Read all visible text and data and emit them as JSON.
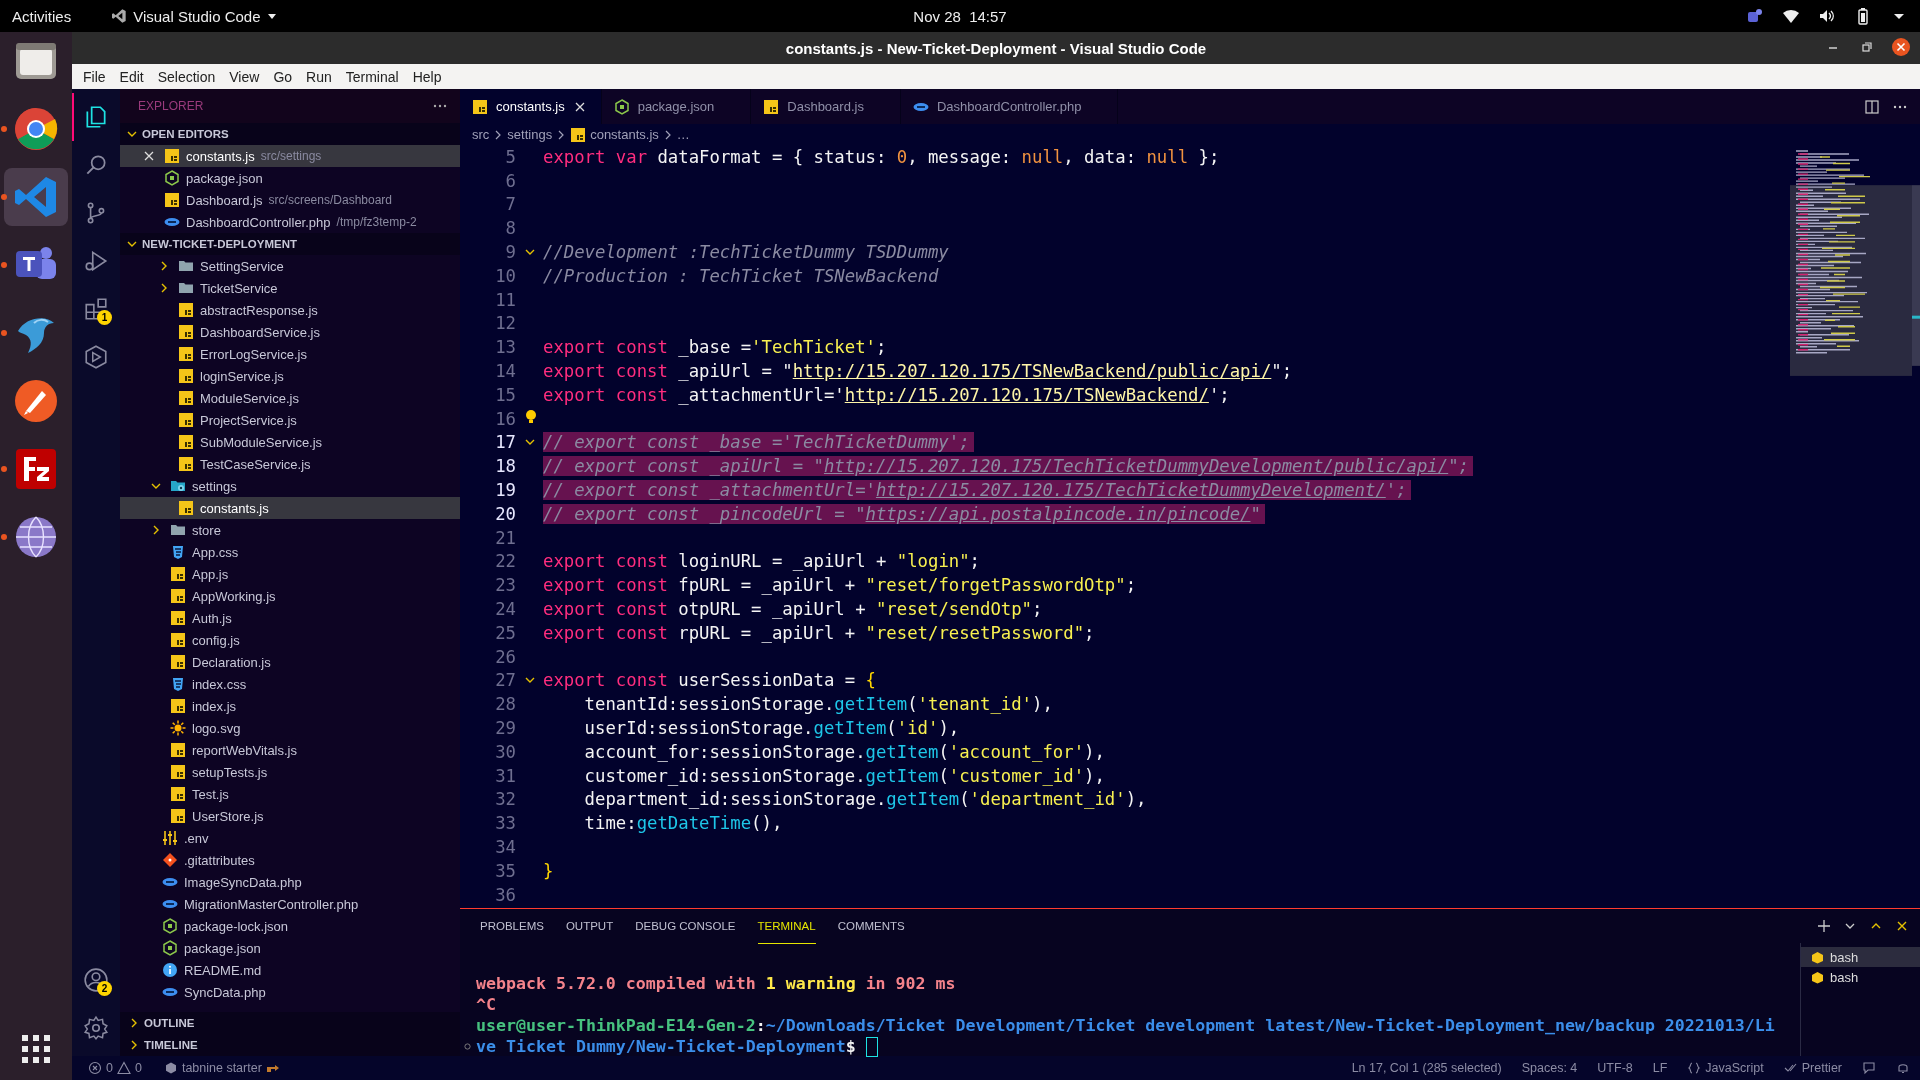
{
  "topbar": {
    "activities": "Activities",
    "app_menu": "Visual Studio Code",
    "clock": "Nov 28  14:57"
  },
  "dock": [
    {
      "kind": "files",
      "running": false,
      "selected": false
    },
    {
      "kind": "browser",
      "running": true,
      "selected": false
    },
    {
      "kind": "code",
      "running": true,
      "selected": true
    },
    {
      "kind": "chat",
      "running": true,
      "selected": false
    },
    {
      "kind": "bird",
      "running": true,
      "selected": false
    },
    {
      "kind": "feather",
      "running": false,
      "selected": false
    },
    {
      "kind": "transfer",
      "running": true,
      "selected": false
    },
    {
      "kind": "globe",
      "running": true,
      "selected": false
    }
  ],
  "window": {
    "title": "constants.js - New-Ticket-Deployment - Visual Studio Code"
  },
  "menu": [
    "File",
    "Edit",
    "Selection",
    "View",
    "Go",
    "Run",
    "Terminal",
    "Help"
  ],
  "activity_bar": [
    {
      "kind": "explorer",
      "selected": true
    },
    {
      "kind": "search",
      "selected": false
    },
    {
      "kind": "source-control",
      "selected": false
    },
    {
      "kind": "run-debug",
      "selected": false
    },
    {
      "kind": "extensions",
      "selected": false,
      "badge": "1"
    },
    {
      "kind": "remote",
      "selected": false
    }
  ],
  "activity_bar_bottom": [
    {
      "kind": "account",
      "badge": "2"
    },
    {
      "kind": "settings"
    }
  ],
  "sidebar": {
    "title": "EXPLORER",
    "open_editors": {
      "title": "OPEN EDITORS",
      "expanded": true,
      "items": [
        {
          "name": "constants.js",
          "path": "src/settings",
          "kind": "js",
          "selected": true
        },
        {
          "name": "package.json",
          "kind": "node",
          "selected": false
        },
        {
          "name": "Dashboard.js",
          "path": "src/screens/Dashboard",
          "kind": "js",
          "selected": false
        },
        {
          "name": "DashboardController.php",
          "path": "/tmp/fz3temp-2",
          "kind": "php",
          "selected": false
        }
      ]
    },
    "project": {
      "title": "NEW-TICKET-DEPLOYMENT",
      "expanded": true,
      "tree": [
        {
          "children": [
            {
              "children": [
                {
                  "label": "SettingService",
                  "kind": "folder",
                  "expanded": false,
                  "selected": false
                },
                {
                  "label": "TicketService",
                  "kind": "folder",
                  "expanded": false,
                  "selected": false
                },
                {
                  "label": "abstractResponse.js",
                  "kind": "js",
                  "selected": false
                },
                {
                  "label": "DashboardService.js",
                  "kind": "js",
                  "selected": false
                },
                {
                  "label": "ErrorLogService.js",
                  "kind": "js",
                  "selected": false
                },
                {
                  "label": "loginService.js",
                  "kind": "js",
                  "selected": false
                },
                {
                  "label": "ModuleService.js",
                  "kind": "js",
                  "selected": false
                },
                {
                  "label": "ProjectService.js",
                  "kind": "js",
                  "selected": false
                },
                {
                  "label": "SubModuleService.js",
                  "kind": "js",
                  "selected": false
                },
                {
                  "label": "TestCaseService.js",
                  "kind": "js",
                  "selected": false
                }
              ]
            },
            {
              "label": "settings",
              "kind": "folder-settings",
              "expanded": true,
              "selected": false,
              "children": [
                {
                  "label": "constants.js",
                  "kind": "js",
                  "selected": true
                }
              ]
            },
            {
              "label": "store",
              "kind": "folder",
              "expanded": false,
              "selected": false
            },
            {
              "label": "App.css",
              "kind": "css",
              "selected": false
            },
            {
              "label": "App.js",
              "kind": "js",
              "selected": false
            },
            {
              "label": "AppWorking.js",
              "kind": "js",
              "selected": false
            },
            {
              "label": "Auth.js",
              "kind": "js",
              "selected": false
            },
            {
              "label": "config.js",
              "kind": "js",
              "selected": false
            },
            {
              "label": "Declaration.js",
              "kind": "js",
              "selected": false
            },
            {
              "label": "index.css",
              "kind": "css",
              "selected": false
            },
            {
              "label": "index.js",
              "kind": "js",
              "selected": false
            },
            {
              "label": "logo.svg",
              "kind": "svg",
              "selected": false
            },
            {
              "label": "reportWebVitals.js",
              "kind": "js",
              "selected": false
            },
            {
              "label": "setupTests.js",
              "kind": "js",
              "selected": false
            },
            {
              "label": "Test.js",
              "kind": "js",
              "selected": false
            },
            {
              "label": "UserStore.js",
              "kind": "js",
              "selected": false
            }
          ]
        },
        {
          "label": ".env",
          "kind": "env",
          "selected": false
        },
        {
          "label": ".gitattributes",
          "kind": "git",
          "selected": false
        },
        {
          "label": "ImageSyncData.php",
          "kind": "php",
          "selected": false
        },
        {
          "label": "MigrationMasterController.php",
          "kind": "php",
          "selected": false
        },
        {
          "label": "package-lock.json",
          "kind": "node",
          "selected": false
        },
        {
          "label": "package.json",
          "kind": "node",
          "selected": false
        },
        {
          "label": "README.md",
          "kind": "info",
          "selected": false
        },
        {
          "label": "SyncData.php",
          "kind": "php",
          "selected": false
        }
      ]
    },
    "sections": [
      {
        "title": "OUTLINE",
        "expanded": false
      },
      {
        "title": "TIMELINE",
        "expanded": false
      }
    ]
  },
  "tabs": [
    {
      "label": "constants.js",
      "kind": "js",
      "selected": true
    },
    {
      "label": "package.json",
      "kind": "node",
      "selected": false
    },
    {
      "label": "Dashboard.js",
      "kind": "js",
      "selected": false
    },
    {
      "label": "DashboardController.php",
      "kind": "php",
      "selected": false
    }
  ],
  "breadcrumb": [
    {
      "label": "src"
    },
    {
      "label": "settings"
    },
    {
      "label": "constants.js",
      "kind": "js"
    },
    {
      "label": "…"
    }
  ],
  "editor": {
    "lines": [
      {
        "number": "5",
        "selected": false,
        "fold": false,
        "hint": false,
        "tokens": [
          {
            "kind": "keyword",
            "text": "export var"
          },
          {
            "kind": "plain",
            "text": " dataFormat = { status: "
          },
          {
            "kind": "number",
            "text": "0"
          },
          {
            "kind": "plain",
            "text": ", message: "
          },
          {
            "kind": "null",
            "text": "null"
          },
          {
            "kind": "plain",
            "text": ", data: "
          },
          {
            "kind": "null",
            "text": "null"
          },
          {
            "kind": "plain",
            "text": " };"
          }
        ]
      },
      {
        "number": "6",
        "selected": false,
        "fold": false,
        "hint": false
      },
      {
        "number": "7",
        "selected": false,
        "fold": false,
        "hint": false
      },
      {
        "number": "8",
        "selected": false,
        "fold": false,
        "hint": false
      },
      {
        "number": "9",
        "selected": false,
        "fold": true,
        "hint": false,
        "tokens": [
          {
            "kind": "comment",
            "text": "//Development :TechTicketDummy TSDDummy"
          }
        ]
      },
      {
        "number": "10",
        "selected": false,
        "fold": false,
        "hint": false,
        "tokens": [
          {
            "kind": "comment",
            "text": "//Production : TechTicket TSNewBackend"
          }
        ]
      },
      {
        "number": "11",
        "selected": false,
        "fold": false,
        "hint": false
      },
      {
        "number": "12",
        "selected": false,
        "fold": false,
        "hint": false
      },
      {
        "number": "13",
        "selected": false,
        "fold": false,
        "hint": false,
        "tokens": [
          {
            "kind": "keyword",
            "text": "export const"
          },
          {
            "kind": "plain",
            "text": " _base ="
          },
          {
            "kind": "string",
            "text": "'TechTicket'"
          },
          {
            "kind": "plain",
            "text": ";"
          }
        ]
      },
      {
        "number": "14",
        "selected": false,
        "fold": false,
        "hint": false,
        "tokens": [
          {
            "kind": "keyword",
            "text": "export const"
          },
          {
            "kind": "plain",
            "text": " _apiUrl = \""
          },
          {
            "kind": "link",
            "text": "http://15.207.120.175/TSNewBackend/public/api/"
          },
          {
            "kind": "plain",
            "text": "\";"
          }
        ]
      },
      {
        "number": "15",
        "selected": false,
        "fold": false,
        "hint": false,
        "tokens": [
          {
            "kind": "keyword",
            "text": "export const"
          },
          {
            "kind": "plain",
            "text": " _attachmentUrl='"
          },
          {
            "kind": "link",
            "text": "http://15.207.120.175/TSNewBackend/"
          },
          {
            "kind": "plain",
            "text": "';"
          }
        ]
      },
      {
        "number": "16",
        "selected": false,
        "fold": false,
        "hint": true
      },
      {
        "number": "17",
        "selected": true,
        "fold": true,
        "hint": false,
        "tokens": [
          {
            "kind": "comment",
            "text": "// export const _base ='TechTicketDummy';"
          }
        ]
      },
      {
        "number": "18",
        "selected": true,
        "fold": false,
        "hint": false,
        "tokens": [
          {
            "kind": "comment",
            "text": "// export const _apiUrl = \""
          },
          {
            "kind": "comment-link",
            "text": "http://15.207.120.175/TechTicketDummyDevelopment/public/api/"
          },
          {
            "kind": "comment",
            "text": "\";"
          }
        ]
      },
      {
        "number": "19",
        "selected": true,
        "fold": false,
        "hint": false,
        "tokens": [
          {
            "kind": "comment",
            "text": "// export const _attachmentUrl='"
          },
          {
            "kind": "comment-link",
            "text": "http://15.207.120.175/TechTicketDummyDevelopment/"
          },
          {
            "kind": "comment",
            "text": "';"
          }
        ]
      },
      {
        "number": "20",
        "selected": true,
        "fold": false,
        "hint": false,
        "tokens": [
          {
            "kind": "comment",
            "text": "// export const _pincodeUrl = \""
          },
          {
            "kind": "comment-link",
            "text": "https://api.postalpincode.in/pincode/"
          },
          {
            "kind": "comment",
            "text": "\""
          }
        ]
      },
      {
        "number": "21",
        "selected": false,
        "fold": false,
        "hint": false
      },
      {
        "number": "22",
        "selected": false,
        "fold": false,
        "hint": false,
        "tokens": [
          {
            "kind": "keyword",
            "text": "export const"
          },
          {
            "kind": "plain",
            "text": " loginURL = _apiUrl + "
          },
          {
            "kind": "string",
            "text": "\"login\""
          },
          {
            "kind": "plain",
            "text": ";"
          }
        ]
      },
      {
        "number": "23",
        "selected": false,
        "fold": false,
        "hint": false,
        "tokens": [
          {
            "kind": "keyword",
            "text": "export const"
          },
          {
            "kind": "plain",
            "text": " fpURL = _apiUrl + "
          },
          {
            "kind": "string",
            "text": "\"reset/forgetPasswordOtp\""
          },
          {
            "kind": "plain",
            "text": ";"
          }
        ]
      },
      {
        "number": "24",
        "selected": false,
        "fold": false,
        "hint": false,
        "tokens": [
          {
            "kind": "keyword",
            "text": "export const"
          },
          {
            "kind": "plain",
            "text": " otpURL = _apiUrl + "
          },
          {
            "kind": "string",
            "text": "\"reset/sendOtp\""
          },
          {
            "kind": "plain",
            "text": ";"
          }
        ]
      },
      {
        "number": "25",
        "selected": false,
        "fold": false,
        "hint": false,
        "tokens": [
          {
            "kind": "keyword",
            "text": "export const"
          },
          {
            "kind": "plain",
            "text": " rpURL = _apiUrl + "
          },
          {
            "kind": "string",
            "text": "\"reset/resetPassword\""
          },
          {
            "kind": "plain",
            "text": ";"
          }
        ]
      },
      {
        "number": "26",
        "selected": false,
        "fold": false,
        "hint": false
      },
      {
        "number": "27",
        "selected": false,
        "fold": true,
        "hint": false,
        "tokens": [
          {
            "kind": "keyword",
            "text": "export const"
          },
          {
            "kind": "plain",
            "text": " userSessionData = "
          },
          {
            "kind": "brace",
            "text": "{"
          }
        ]
      },
      {
        "number": "28",
        "selected": false,
        "fold": false,
        "hint": false,
        "tokens": [
          {
            "kind": "plain",
            "text": "    tenantId:sessionStorage."
          },
          {
            "kind": "function",
            "text": "getItem"
          },
          {
            "kind": "plain",
            "text": "("
          },
          {
            "kind": "string",
            "text": "'tenant_id'"
          },
          {
            "kind": "plain",
            "text": "),"
          }
        ]
      },
      {
        "number": "29",
        "selected": false,
        "fold": false,
        "hint": false,
        "tokens": [
          {
            "kind": "plain",
            "text": "    userId:sessionStorage."
          },
          {
            "kind": "function",
            "text": "getItem"
          },
          {
            "kind": "plain",
            "text": "("
          },
          {
            "kind": "string",
            "text": "'id'"
          },
          {
            "kind": "plain",
            "text": "),"
          }
        ]
      },
      {
        "number": "30",
        "selected": false,
        "fold": false,
        "hint": false,
        "tokens": [
          {
            "kind": "plain",
            "text": "    account_for:sessionStorage."
          },
          {
            "kind": "function",
            "text": "getItem"
          },
          {
            "kind": "plain",
            "text": "("
          },
          {
            "kind": "string",
            "text": "'account_for'"
          },
          {
            "kind": "plain",
            "text": "),"
          }
        ]
      },
      {
        "number": "31",
        "selected": false,
        "fold": false,
        "hint": false,
        "tokens": [
          {
            "kind": "plain",
            "text": "    customer_id:sessionStorage."
          },
          {
            "kind": "function",
            "text": "getItem"
          },
          {
            "kind": "plain",
            "text": "("
          },
          {
            "kind": "string",
            "text": "'customer_id'"
          },
          {
            "kind": "plain",
            "text": "),"
          }
        ]
      },
      {
        "number": "32",
        "selected": false,
        "fold": false,
        "hint": false,
        "tokens": [
          {
            "kind": "plain",
            "text": "    department_id:sessionStorage."
          },
          {
            "kind": "function",
            "text": "getItem"
          },
          {
            "kind": "plain",
            "text": "("
          },
          {
            "kind": "string",
            "text": "'department_id'"
          },
          {
            "kind": "plain",
            "text": "),"
          }
        ]
      },
      {
        "number": "33",
        "selected": false,
        "fold": false,
        "hint": false,
        "tokens": [
          {
            "kind": "plain",
            "text": "    time:"
          },
          {
            "kind": "function",
            "text": "getDateTime"
          },
          {
            "kind": "plain",
            "text": "(),"
          }
        ]
      },
      {
        "number": "34",
        "selected": false,
        "fold": false,
        "hint": false
      },
      {
        "number": "35",
        "selected": false,
        "fold": false,
        "hint": false,
        "tokens": [
          {
            "kind": "brace",
            "text": "}"
          }
        ]
      },
      {
        "number": "36",
        "selected": false,
        "fold": false,
        "hint": false
      }
    ]
  },
  "panel": {
    "tabs": [
      {
        "label": "PROBLEMS",
        "selected": false
      },
      {
        "label": "OUTPUT",
        "selected": false
      },
      {
        "label": "DEBUG CONSOLE",
        "selected": false
      },
      {
        "label": "TERMINAL",
        "selected": true
      },
      {
        "label": "COMMENTS",
        "selected": false
      }
    ],
    "terminal": {
      "lines": [
        {
          "mark": false,
          "cursor": false,
          "tokens": [
            {
              "kind": "message",
              "text": "webpack 5.72.0 compiled with "
            },
            {
              "kind": "warning",
              "text": "1 warning"
            },
            {
              "kind": "message",
              "text": " in 902 ms"
            }
          ]
        },
        {
          "mark": false,
          "cursor": false,
          "tokens": [
            {
              "kind": "message",
              "text": "^C"
            }
          ]
        },
        {
          "mark": false,
          "cursor": false,
          "tokens": [
            {
              "kind": "user",
              "text": "user@user-ThinkPad-E14-Gen-2"
            },
            {
              "kind": "plain",
              "text": ":"
            },
            {
              "kind": "path",
              "text": "~/Downloads/Ticket Development/Ticket development latest/New-Ticket-Deployment_new/backup 20221013/Li"
            }
          ]
        },
        {
          "mark": true,
          "cursor": true,
          "tokens": [
            {
              "kind": "path",
              "text": "ve Ticket Dummy/New-Ticket-Deployment"
            },
            {
              "kind": "plain",
              "text": "$ "
            }
          ]
        }
      ]
    },
    "sessions": [
      {
        "label": "bash",
        "selected": true
      },
      {
        "label": "bash",
        "selected": false
      }
    ]
  },
  "status_bar": {
    "errors": "0",
    "warnings": "0",
    "tabnine": "tabnine starter",
    "position": "Ln 17, Col 1 (285 selected)",
    "spaces": "Spaces: 4",
    "encoding": "UTF-8",
    "eol": "LF",
    "language": "JavaScript",
    "formatter": "Prettier"
  }
}
